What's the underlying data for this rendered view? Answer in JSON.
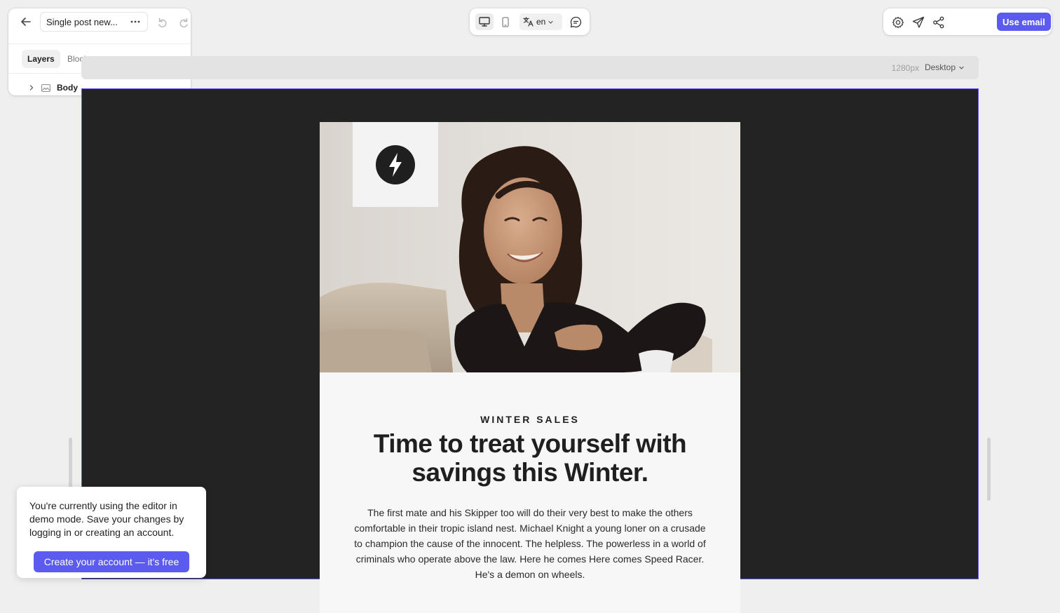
{
  "document": {
    "title": "Single post new...",
    "more_icon": "ellipsis-icon"
  },
  "left_panel": {
    "tabs": [
      {
        "label": "Layers",
        "active": true
      },
      {
        "label": "Blocks",
        "active": false
      }
    ],
    "layers": [
      {
        "label": "Body",
        "icon": "image-layer-icon",
        "expanded": false
      }
    ]
  },
  "center_toolbar": {
    "device_active": "desktop",
    "language": "en"
  },
  "right_toolbar": {
    "use_email_label": "Use email"
  },
  "viewport": {
    "width_label": "1280px",
    "device_label": "Desktop"
  },
  "email": {
    "eyebrow": "WINTER SALES",
    "headline": "Time to treat yourself with savings this Winter.",
    "body": "The first mate and his Skipper too will do their very best to make the others comfortable in their tropic island nest. Michael Knight a young loner on a crusade to champion the cause of the innocent. The helpless. The powerless in a world of criminals who operate above the law. Here he comes Here comes Speed Racer. He's a demon on wheels."
  },
  "demo_notice": {
    "text": "You're currently using the editor in demo mode. Save your changes by logging in or creating an account.",
    "cta_label": "Create your account — it's free"
  },
  "colors": {
    "accent": "#5b5bf0",
    "canvas_bg": "#232323",
    "email_bg": "#f7f7f7"
  }
}
